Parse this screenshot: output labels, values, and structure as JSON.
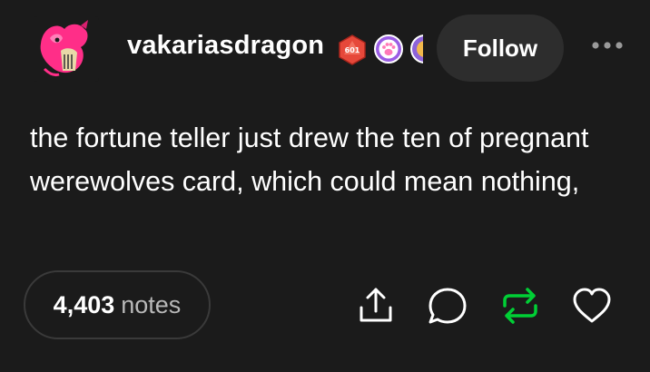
{
  "post": {
    "username": "vakariasdragon",
    "follow_label": "Follow",
    "body_text": "the fortune teller just drew the ten of pregnant werewolves card, which could mean nothing,",
    "badge_text": "601"
  },
  "footer": {
    "notes_count": "4,403",
    "notes_label": "notes"
  },
  "icons": {
    "more": "more-horizontal-icon",
    "share": "share-icon",
    "reply": "reply-icon",
    "reblog": "reblog-icon",
    "like": "heart-icon"
  },
  "colors": {
    "background": "#1b1b1b",
    "follow_button": "#2d2d2d",
    "reblog_green": "#00cf35",
    "avatar_pink": "#ff2e88",
    "badge_red": "#e6483a",
    "badge_purple": "#9b5de5"
  }
}
